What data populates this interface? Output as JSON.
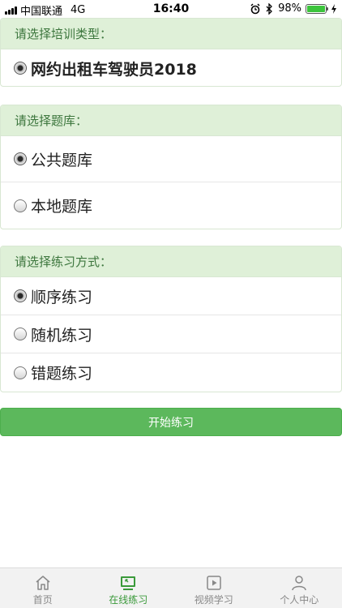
{
  "status_bar": {
    "carrier": "中国联通",
    "network": "4G",
    "time": "16:40",
    "battery": "98%",
    "battery_level": 0.98
  },
  "training_type": {
    "header": "请选择培训类型：",
    "options": [
      {
        "label": "网约出租车驾驶员2018",
        "checked": true
      }
    ]
  },
  "question_bank": {
    "header": "请选择题库：",
    "options": [
      {
        "label": "公共题库",
        "checked": true
      },
      {
        "label": "本地题库",
        "checked": false
      }
    ]
  },
  "practice_mode": {
    "header": "请选择练习方式：",
    "options": [
      {
        "label": "顺序练习",
        "checked": true
      },
      {
        "label": "随机练习",
        "checked": false
      },
      {
        "label": "错题练习",
        "checked": false
      }
    ]
  },
  "start_button": "开始练习",
  "tab_bar": {
    "tabs": [
      {
        "label": "首页",
        "icon": "home-icon",
        "active": false
      },
      {
        "label": "在线练习",
        "icon": "online-practice-icon",
        "active": true
      },
      {
        "label": "视频学习",
        "icon": "video-icon",
        "active": false
      },
      {
        "label": "个人中心",
        "icon": "user-icon",
        "active": false
      }
    ]
  },
  "colors": {
    "accent": "#5cb85c",
    "header_bg": "#dff0d8",
    "header_text": "#3c763d",
    "tab_active": "#3a9a3a"
  }
}
